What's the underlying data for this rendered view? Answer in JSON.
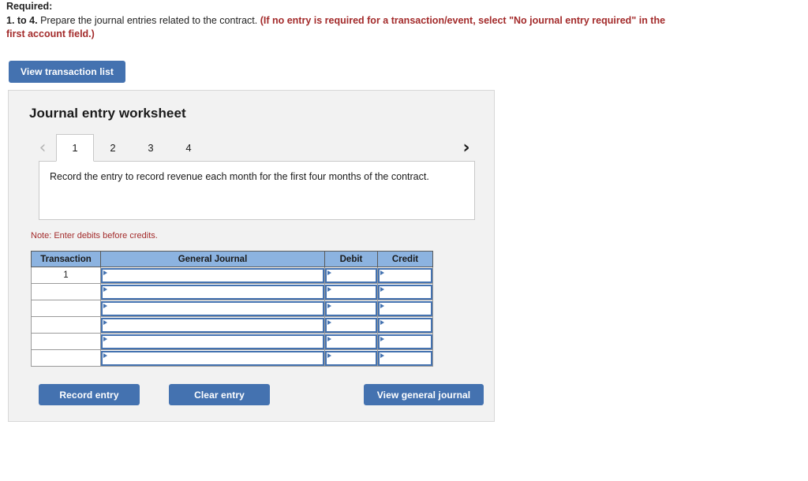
{
  "instructions": {
    "required_label": "Required:",
    "item_number": "1. to 4.",
    "item_text": " Prepare the journal entries related to the contract. ",
    "highlight_text": "(If no entry is required for a transaction/event, select \"No journal entry required\" in the first account field.)"
  },
  "toolbar": {
    "view_transaction_list": "View transaction list"
  },
  "worksheet": {
    "title": "Journal entry worksheet",
    "nav": {
      "prev_icon": "chevron-left",
      "prev_glyph": "‹",
      "next_icon": "chevron-right",
      "next_glyph": "›"
    },
    "tabs": [
      {
        "label": "1",
        "active": true
      },
      {
        "label": "2",
        "active": false
      },
      {
        "label": "3",
        "active": false
      },
      {
        "label": "4",
        "active": false
      }
    ],
    "active_tab_description": "Record the entry to record revenue each month for the first four months of the contract.",
    "note": "Note: Enter debits before credits.",
    "table": {
      "columns": [
        "Transaction",
        "General Journal",
        "Debit",
        "Credit"
      ],
      "rows": [
        {
          "transaction": "1",
          "general_journal": "",
          "debit": "",
          "credit": ""
        },
        {
          "transaction": "",
          "general_journal": "",
          "debit": "",
          "credit": ""
        },
        {
          "transaction": "",
          "general_journal": "",
          "debit": "",
          "credit": ""
        },
        {
          "transaction": "",
          "general_journal": "",
          "debit": "",
          "credit": ""
        },
        {
          "transaction": "",
          "general_journal": "",
          "debit": "",
          "credit": ""
        },
        {
          "transaction": "",
          "general_journal": "",
          "debit": "",
          "credit": ""
        }
      ]
    },
    "buttons": {
      "record_entry": "Record entry",
      "clear_entry": "Clear entry",
      "view_general_journal": "View general journal"
    }
  },
  "colors": {
    "button_blue": "#4472b0",
    "header_blue": "#8cb3e0",
    "alert_red": "#a32b2b",
    "panel_gray": "#f2f2f2"
  }
}
